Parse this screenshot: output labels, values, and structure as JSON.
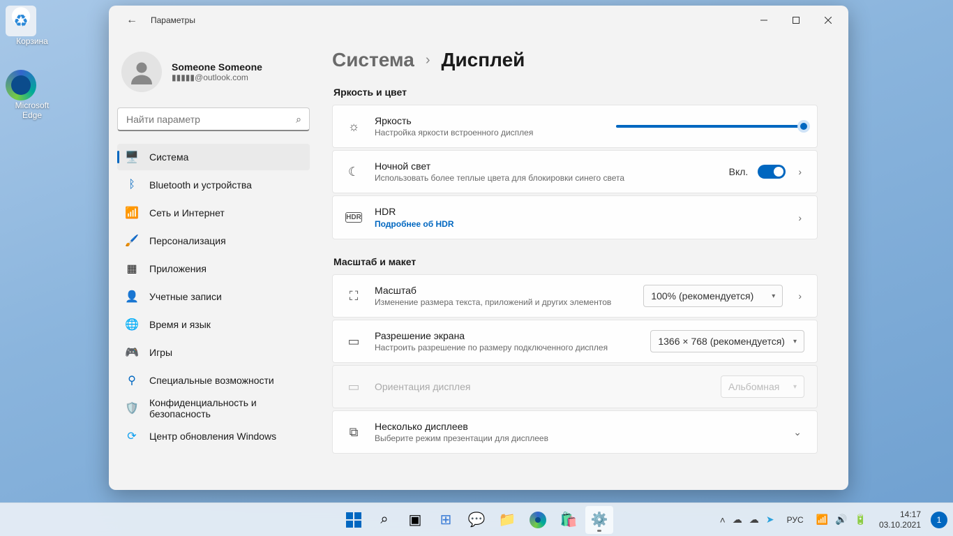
{
  "desktop": {
    "recycle_bin": "Корзина",
    "edge": "Microsoft Edge"
  },
  "window": {
    "app_title": "Параметры",
    "user": {
      "name": "Someone Someone",
      "email": "▮▮▮▮▮@outlook.com"
    },
    "search_placeholder": "Найти параметр",
    "nav": {
      "system": "Система",
      "bluetooth": "Bluetooth и устройства",
      "network": "Сеть и Интернет",
      "personalization": "Персонализация",
      "apps": "Приложения",
      "accounts": "Учетные записи",
      "time": "Время и язык",
      "gaming": "Игры",
      "accessibility": "Специальные возможности",
      "privacy": "Конфиденциальность и безопасность",
      "update": "Центр обновления Windows"
    },
    "breadcrumb": {
      "parent": "Система",
      "current": "Дисплей"
    },
    "section_brightness": "Яркость и цвет",
    "brightness": {
      "title": "Яркость",
      "sub": "Настройка яркости встроенного дисплея",
      "value": 100
    },
    "nightlight": {
      "title": "Ночной свет",
      "sub": "Использовать более теплые цвета для блокировки синего света",
      "state_label": "Вкл."
    },
    "hdr": {
      "title": "HDR",
      "link": "Подробнее об HDR"
    },
    "section_scale": "Масштаб и макет",
    "scale": {
      "title": "Масштаб",
      "sub": "Изменение размера текста, приложений и других элементов",
      "value": "100% (рекомендуется)"
    },
    "resolution": {
      "title": "Разрешение экрана",
      "sub": "Настроить разрешение по размеру подключенного дисплея",
      "value": "1366 × 768 (рекомендуется)"
    },
    "orientation": {
      "title": "Ориентация дисплея",
      "value": "Альбомная"
    },
    "multimonitor": {
      "title": "Несколько дисплеев",
      "sub": "Выберите режим презентации для дисплеев"
    }
  },
  "taskbar": {
    "lang": "РУС",
    "time": "14:17",
    "date": "03.10.2021",
    "notif_count": "1"
  }
}
